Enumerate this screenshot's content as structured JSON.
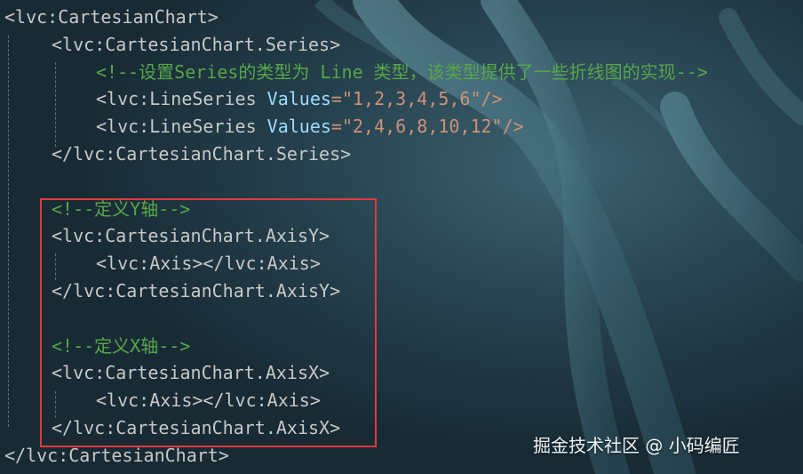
{
  "editor": {
    "colors": {
      "background": "#1f3440",
      "tag": "#c8c8c8",
      "comment": "#57a64a",
      "attribute": "#9cdcfe",
      "highlight_border": "#e3393c"
    },
    "lines": [
      {
        "tokens": [
          {
            "t": "<lvc:CartesianChart>",
            "k": "tag"
          }
        ]
      },
      {
        "tokens": [
          {
            "t": "<lvc:CartesianChart.Series>",
            "k": "tag"
          }
        ]
      },
      {
        "tokens": [
          {
            "t": "<!--设置Series的类型为 Line 类型，该类型提供了一些折线图的实现-->",
            "k": "comment"
          }
        ]
      },
      {
        "tokens": [
          {
            "t": "<lvc:LineSeries ",
            "k": "tag"
          },
          {
            "t": "Values",
            "k": "attribute"
          },
          {
            "t": "=\"1,2,3,4,5,6\"/>",
            "k": "string"
          }
        ]
      },
      {
        "tokens": [
          {
            "t": "<lvc:LineSeries ",
            "k": "tag"
          },
          {
            "t": "Values",
            "k": "attribute"
          },
          {
            "t": "=\"2,4,6,8,10,12\"/>",
            "k": "string"
          }
        ]
      },
      {
        "tokens": [
          {
            "t": "</lvc:CartesianChart.Series>",
            "k": "tag"
          }
        ]
      },
      {
        "tokens": []
      },
      {
        "tokens": [
          {
            "t": "<!--定义Y轴-->",
            "k": "comment"
          }
        ]
      },
      {
        "tokens": [
          {
            "t": "<lvc:CartesianChart.AxisY>",
            "k": "tag"
          }
        ]
      },
      {
        "tokens": [
          {
            "t": "<lvc:Axis></lvc:Axis>",
            "k": "tag"
          }
        ]
      },
      {
        "tokens": [
          {
            "t": "</lvc:CartesianChart.AxisY>",
            "k": "tag"
          }
        ]
      },
      {
        "tokens": []
      },
      {
        "tokens": [
          {
            "t": "<!--定义X轴-->",
            "k": "comment"
          }
        ]
      },
      {
        "tokens": [
          {
            "t": "<lvc:CartesianChart.AxisX>",
            "k": "tag"
          }
        ]
      },
      {
        "tokens": [
          {
            "t": "<lvc:Axis></lvc:Axis>",
            "k": "tag"
          }
        ]
      },
      {
        "tokens": [
          {
            "t": "</lvc:CartesianChart.AxisX>",
            "k": "tag"
          }
        ]
      },
      {
        "tokens": [
          {
            "t": "</lvc:CartesianChart>",
            "k": "tag"
          }
        ]
      }
    ]
  },
  "watermark": "掘金技术社区 @ 小码编匠"
}
